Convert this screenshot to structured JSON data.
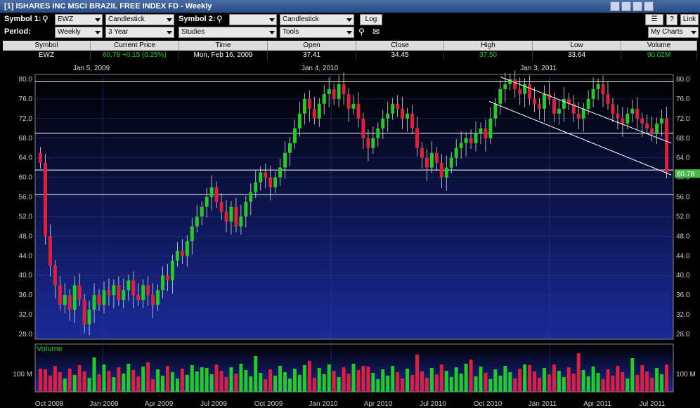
{
  "window": {
    "title": "[1] ISHARES INC MSCI BRAZIL FREE INDEX FD - Weekly",
    "help_label": "?",
    "link_label": "Link"
  },
  "toolbar": {
    "symbol1_label": "Symbol 1:",
    "symbol1_value": "EWZ",
    "chart_type1": "Candlestick",
    "symbol2_label": "Symbol 2:",
    "symbol2_value": "",
    "chart_type2": "Candlestick",
    "log_label": "Log",
    "period_label": "Period:",
    "period_value": "Weekly",
    "range_value": "3 Year",
    "studies_value": "Studies",
    "tools_value": "Tools",
    "my_charts_value": "My Charts"
  },
  "quote": {
    "headers": [
      "Symbol",
      "Current Price",
      "Time",
      "Open",
      "Close",
      "High",
      "Low",
      "Volume"
    ],
    "symbol": "EWZ",
    "current_price": "60.78 +0.15 (0.25%)",
    "time": "Mon, Feb 16, 2009",
    "open": "37.41",
    "close": "34.45",
    "high": "37.50",
    "low": "33.64",
    "volume": "90.02M"
  },
  "colors": {
    "up": "#22cc22",
    "down": "#e0203a",
    "bg_top": "#000000",
    "bg_bottom": "#1a2a9a",
    "price_tag": "#44bb44",
    "volume_label": "#22cc22"
  },
  "chart_data": {
    "type": "candlestick",
    "ylim": [
      27,
      81
    ],
    "yticks": [
      "80.0",
      "76.0",
      "72.0",
      "68.0",
      "64.0",
      "60.0",
      "56.0",
      "52.0",
      "48.0",
      "44.0",
      "40.0",
      "36.0",
      "32.0",
      "28.0"
    ],
    "top_dates": [
      "Jan 5, 2009",
      "Jan 4, 2010",
      "Jan 3, 2011"
    ],
    "x_labels": [
      "Oct 2008",
      "Jan 2009",
      "Apr 2009",
      "Jul 2009",
      "Oct 2009",
      "Jan 2010",
      "Apr 2010",
      "Jul 2010",
      "Oct 2010",
      "Jan 2011",
      "Apr 2011",
      "Jul 2011"
    ],
    "last_price_tag": "60.78",
    "volume_title": "Volume",
    "volume_tick": "100 M",
    "hlines": [
      79.5,
      69.0,
      61.5,
      56.5
    ],
    "closes": [
      63,
      48,
      42,
      38,
      34,
      36,
      33,
      38,
      35,
      30,
      33,
      36,
      34,
      37,
      36,
      38,
      35,
      37,
      39,
      36,
      35,
      38,
      36,
      34,
      37,
      40,
      39,
      43,
      45,
      44,
      47,
      50,
      52,
      54,
      56,
      58,
      55,
      53,
      51,
      54,
      50,
      52,
      55,
      57,
      59,
      61,
      60,
      58,
      60,
      62,
      65,
      67,
      70,
      73,
      76,
      74,
      72,
      75,
      77,
      78,
      76,
      79,
      77,
      74,
      75,
      72,
      68,
      66,
      68,
      70,
      72,
      73,
      75,
      74,
      72,
      73,
      70,
      66,
      64,
      62,
      65,
      63,
      60,
      62,
      64,
      66,
      67,
      68,
      67,
      69,
      70,
      68,
      72,
      75,
      78,
      79,
      80,
      78,
      77,
      79,
      76,
      75,
      74,
      77,
      76,
      73,
      74,
      76,
      75,
      73,
      72,
      74,
      76,
      78,
      79,
      77,
      75,
      73,
      72,
      71,
      73,
      74,
      72,
      71,
      70,
      69,
      71,
      72,
      61
    ]
  }
}
